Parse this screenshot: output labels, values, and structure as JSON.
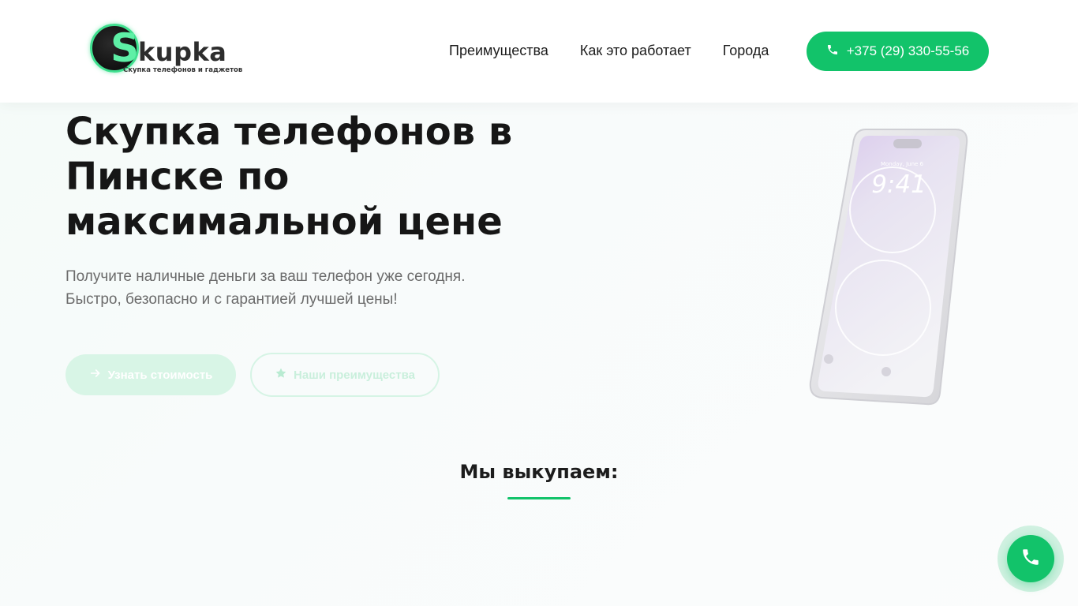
{
  "header": {
    "logo": {
      "letter": "S",
      "word": "kupka",
      "tagline": "Скупка телефонов и гаджетов"
    },
    "nav": [
      {
        "label": "Преимущества"
      },
      {
        "label": "Как это работает"
      },
      {
        "label": "Города"
      }
    ],
    "phone": "+375 (29) 330-55-56"
  },
  "hero": {
    "title": "Скупка телефонов в Пинске по максимальной цене",
    "subtitle": "Получите наличные деньги за ваш телефон уже сегодня. Быстро, безопасно и с гарантией лучшей цены!",
    "cta_primary": "Узнать стоимость",
    "cta_secondary": "Наши преимущества",
    "phone_screen_date": "Monday, June 6",
    "phone_screen_time": "9:41"
  },
  "section": {
    "title": "Мы выкупаем:"
  },
  "colors": {
    "accent": "#12c36a",
    "accent_light": "#d8f5e6",
    "logo_glow": "#3fe08f",
    "text_dark": "#161616",
    "text_muted": "#6b6b6b"
  },
  "icons": {
    "phone": "phone-icon",
    "arrow": "arrow-right-icon",
    "star": "star-icon",
    "float_call": "phone-icon"
  }
}
